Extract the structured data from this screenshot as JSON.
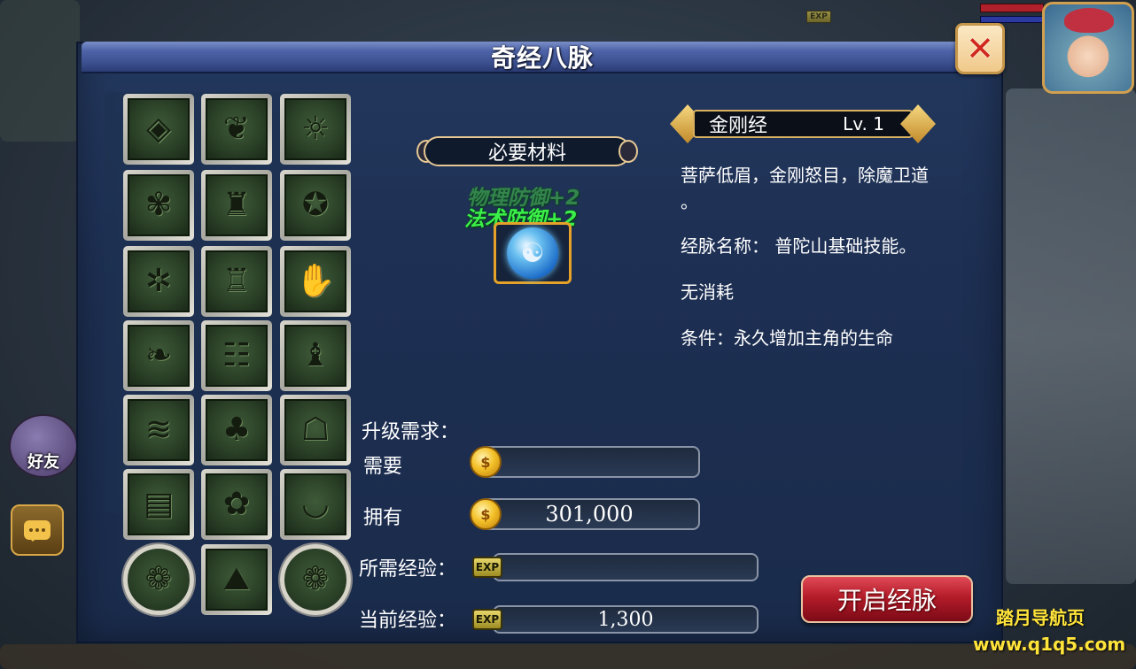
{
  "window": {
    "title": "奇经八脉"
  },
  "hud": {
    "friend_label": "好友",
    "exp_tag": "EXP"
  },
  "skills": [
    {
      "name": "skill-diamond",
      "glyph": "◈"
    },
    {
      "name": "skill-bird",
      "glyph": "❦"
    },
    {
      "name": "skill-sun",
      "glyph": "☼"
    },
    {
      "name": "skill-lotus",
      "glyph": "✾"
    },
    {
      "name": "skill-bell",
      "glyph": "♜"
    },
    {
      "name": "skill-paw",
      "glyph": "✪"
    },
    {
      "name": "skill-spider",
      "glyph": "✲"
    },
    {
      "name": "skill-vase",
      "glyph": "♖"
    },
    {
      "name": "skill-hand",
      "glyph": "✋"
    },
    {
      "name": "skill-leaf",
      "glyph": "❧"
    },
    {
      "name": "skill-bamboo",
      "glyph": "☷"
    },
    {
      "name": "skill-penguin",
      "glyph": "♝"
    },
    {
      "name": "skill-wave",
      "glyph": "≋"
    },
    {
      "name": "skill-frog",
      "glyph": "♣"
    },
    {
      "name": "skill-arch",
      "glyph": "☖"
    },
    {
      "name": "skill-scroll",
      "glyph": "▤"
    },
    {
      "name": "skill-flower",
      "glyph": "✿"
    },
    {
      "name": "skill-boat",
      "glyph": "◡"
    },
    {
      "name": "skill-knot-left",
      "glyph": "❁"
    },
    {
      "name": "skill-mountain",
      "glyph": "⛰"
    },
    {
      "name": "skill-knot-right",
      "glyph": "❁"
    }
  ],
  "material": {
    "header": "必要材料",
    "bonus_1": "物理防御+2",
    "bonus_2": "法术防御+2",
    "item_glyph": "☯"
  },
  "detail": {
    "skill_name": "金刚经",
    "level": "Lv. 1",
    "desc_line1": "菩萨低眉，金刚怒目，除魔卫道",
    "desc_line2": "。",
    "meridian": "经脉名称：  普陀山基础技能。",
    "cost": "无消耗",
    "condition": "条件：永久增加主角的生命"
  },
  "requirements": {
    "heading": "升级需求：",
    "need_label": "需要",
    "need_value": "",
    "have_label": "拥有",
    "have_value": "301,000",
    "exp_needed_label": "所需经验：",
    "exp_needed_value": "",
    "exp_current_label": "当前经验：",
    "exp_current_value": "1,300",
    "coin_glyph": "$",
    "exp_badge": "EXP"
  },
  "actions": {
    "open_meridian": "开启经脉"
  },
  "watermark": {
    "line1": "踏月导航页",
    "line2": "www.q1q5.com"
  },
  "colors": {
    "accent_gold": "#e6a228",
    "bonus_green": "#3bf04a",
    "button_red": "#b41c2a"
  }
}
